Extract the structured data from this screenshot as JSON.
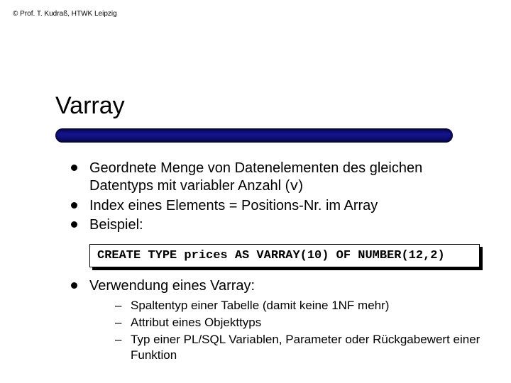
{
  "copyright": "©   Prof. T. Kudraß, HTWK Leipzig",
  "title": "Varray",
  "bullets": {
    "b1_a": "Geordnete Menge von Datenelementen des gleichen Datentyps mit variabler Anzahl (",
    "b1_v": "v",
    "b1_b": ")",
    "b2": "Index eines Elements = Positions-Nr. im Array",
    "b3": "Beispiel:"
  },
  "code": "CREATE TYPE prices AS VARRAY(10) OF NUMBER(12,2)",
  "usage": {
    "heading": "Verwendung eines Varray:",
    "items": [
      "Spaltentyp einer Tabelle (damit keine 1NF mehr)",
      "Attribut eines Objekttyps",
      "Typ einer PL/SQL Variablen, Parameter oder Rückgabewert einer Funktion"
    ]
  }
}
